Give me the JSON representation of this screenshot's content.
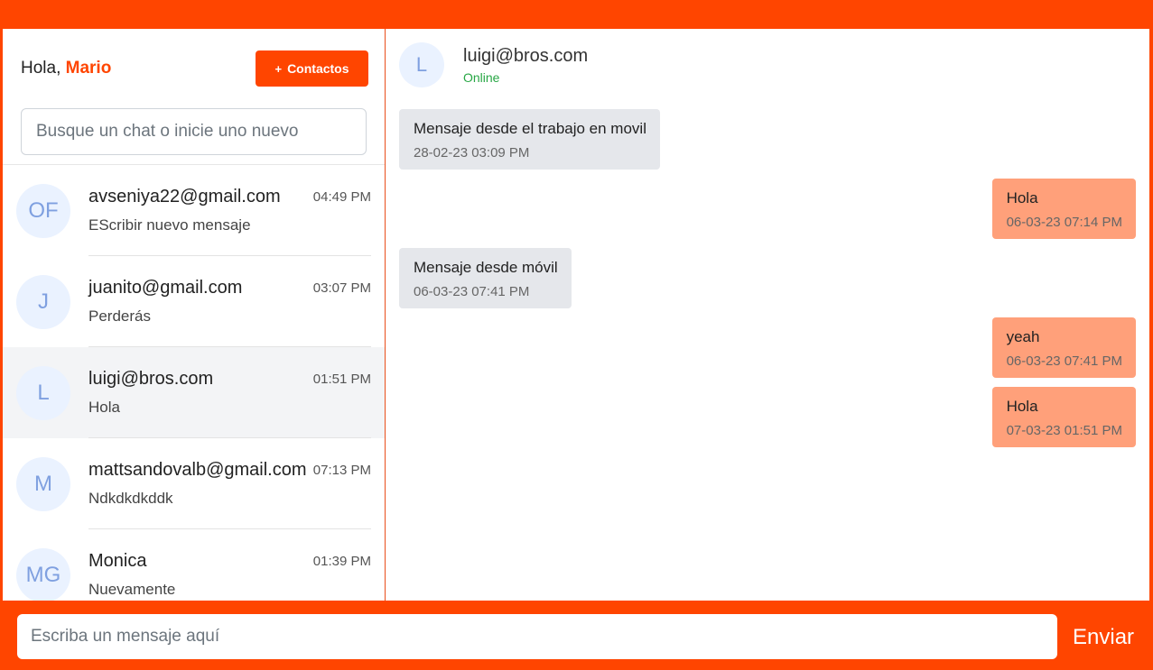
{
  "sidebar": {
    "greeting": "Hola,",
    "user_name": "Mario",
    "contacts_button": {
      "icon": "+",
      "label": "Contactos"
    },
    "search_placeholder": "Busque un chat o inicie uno nuevo",
    "chats": [
      {
        "initials": "OF",
        "name": "avseniya22@gmail.com",
        "time": "04:49 PM",
        "preview": "EScribir nuevo mensaje",
        "active": false
      },
      {
        "initials": "J",
        "name": "juanito@gmail.com",
        "time": "03:07 PM",
        "preview": "Perderás",
        "active": false
      },
      {
        "initials": "L",
        "name": "luigi@bros.com",
        "time": "01:51 PM",
        "preview": "Hola",
        "active": true
      },
      {
        "initials": "M",
        "name": "mattsandovalb@gmail.com",
        "time": "07:13 PM",
        "preview": "Ndkdkdkddk",
        "active": false
      },
      {
        "initials": "MG",
        "name": "Monica",
        "time": "01:39 PM",
        "preview": "Nuevamente",
        "active": false
      }
    ]
  },
  "conversation": {
    "contact_initial": "L",
    "contact_name": "luigi@bros.com",
    "contact_status": "Online",
    "messages": [
      {
        "direction": "in",
        "text": "Mensaje desde el trabajo en movil",
        "time": "28-02-23 03:09 PM"
      },
      {
        "direction": "out",
        "text": "Hola",
        "time": "06-03-23 07:14 PM"
      },
      {
        "direction": "in",
        "text": "Mensaje desde móvil",
        "time": "06-03-23 07:41 PM"
      },
      {
        "direction": "out",
        "text": "yeah",
        "time": "06-03-23 07:41 PM"
      },
      {
        "direction": "out",
        "text": "Hola",
        "time": "07-03-23 01:51 PM"
      }
    ]
  },
  "composer": {
    "placeholder": "Escriba un mensaje aquí",
    "send_label": "Enviar"
  },
  "colors": {
    "brand": "#ff4500",
    "outgoing_bubble": "#ffa07a",
    "incoming_bubble": "#e5e7eb",
    "online": "#28a745"
  }
}
